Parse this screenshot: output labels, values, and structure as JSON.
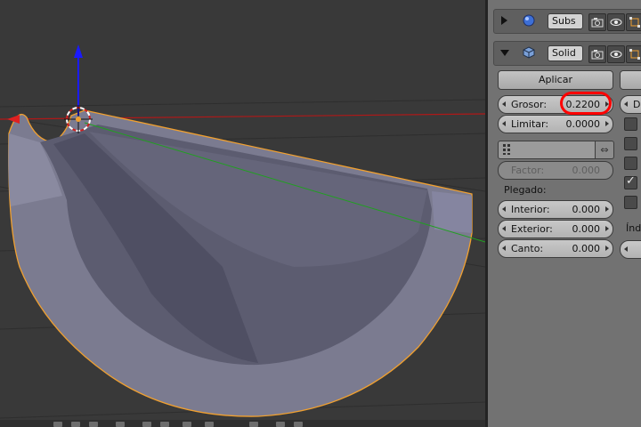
{
  "modifiers": [
    {
      "name": "Subs",
      "expanded": false
    },
    {
      "name": "Solid",
      "expanded": true
    }
  ],
  "solidify": {
    "apply_label": "Aplicar",
    "right_cut_label": "D",
    "grosor_label": "Grosor:",
    "grosor_value": "0.2200",
    "limitar_label": "Limitar:",
    "limitar_value": "0.0000",
    "factor_label": "Factor:",
    "factor_value": "0.000",
    "plegado_label": "Plegado:",
    "interior_label": "Interior:",
    "interior_value": "0.000",
    "exterior_label": "Exterior:",
    "exterior_value": "0.000",
    "canto_label": "Canto:",
    "canto_value": "0.000",
    "indice_label": "Índ",
    "checkboxes": [
      false,
      false,
      false,
      true,
      false
    ]
  },
  "colors": {
    "selection_outline": "#f0a030",
    "highlight_ring": "#ff0000",
    "z_axis": "#1a1aff",
    "x_axis": "#d01010",
    "y_axis": "#20a020"
  },
  "icons": [
    "modifier-sphere-icon",
    "cube-icon",
    "camera-render-icon",
    "eye-icon",
    "editmode-icon",
    "vertex-group-icon",
    "swap-icon"
  ]
}
